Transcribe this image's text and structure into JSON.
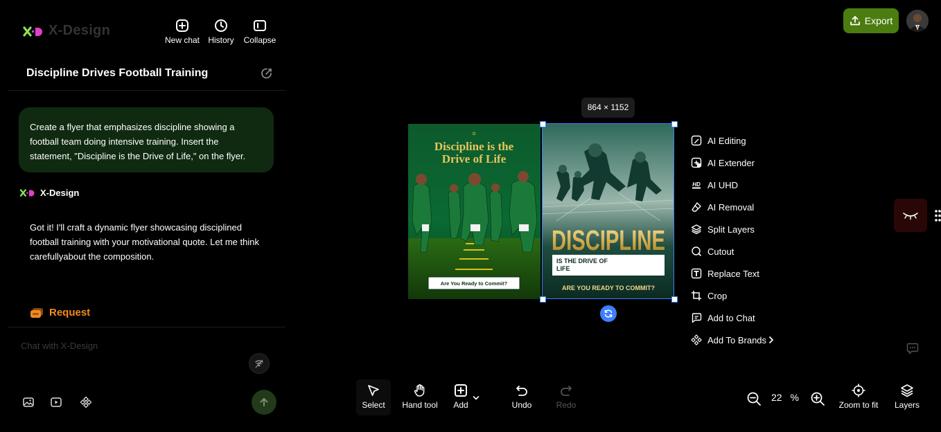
{
  "app": {
    "name": "X-Design"
  },
  "header": {
    "new_chat": "New chat",
    "history": "History",
    "collapse": "Collapse",
    "export": "Export"
  },
  "chat": {
    "title": "Discipline Drives Football Training",
    "user_message": "Create a flyer that emphasizes discipline showing a football team doing intensive training. Insert the statement, \"Discipline is the Drive of Life,\" on the flyer.",
    "assistant_name": "X-Design",
    "assistant_message": "Got it! I'll craft a dynamic flyer showcasing disciplined football training with your motivational quote. Let me think carefullyabout the composition.",
    "request_label": "Request",
    "input_placeholder": "Chat with X-Design"
  },
  "canvas": {
    "dimensions": "864 × 1152",
    "flyer1": {
      "headline": "Discipline is the Drive of Life",
      "cta": "Are You Ready to Commit?"
    },
    "flyer2": {
      "headline": "DISCIPLINE",
      "sub": "IS THE DRIVE OF LIFE",
      "cta": "ARE YOU READY TO COMMIT?"
    }
  },
  "context_menu": [
    {
      "label": "AI Editing",
      "icon": "ai-editing-icon"
    },
    {
      "label": "AI Extender",
      "icon": "ai-extender-icon"
    },
    {
      "label": "AI UHD",
      "icon": "hd-icon"
    },
    {
      "label": "AI Removal",
      "icon": "eraser-icon"
    },
    {
      "label": "Split Layers",
      "icon": "layers-icon"
    },
    {
      "label": "Cutout",
      "icon": "cutout-icon"
    },
    {
      "label": "Replace Text",
      "icon": "text-icon"
    },
    {
      "label": "Crop",
      "icon": "crop-icon"
    },
    {
      "label": "Add to Chat",
      "icon": "chat-icon"
    },
    {
      "label": "Add To Brands",
      "icon": "brand-icon"
    }
  ],
  "toolbar": {
    "select": "Select",
    "hand": "Hand tool",
    "add": "Add",
    "undo": "Undo",
    "redo": "Redo",
    "zoom_value": "22",
    "zoom_unit": "%",
    "zoom_fit": "Zoom to fit",
    "layers": "Layers"
  },
  "colors": {
    "accent_green": "#4b7c0f",
    "bubble_green": "#0f2a10",
    "request_orange": "#f28b1b",
    "selection_blue": "#3d7fff"
  }
}
